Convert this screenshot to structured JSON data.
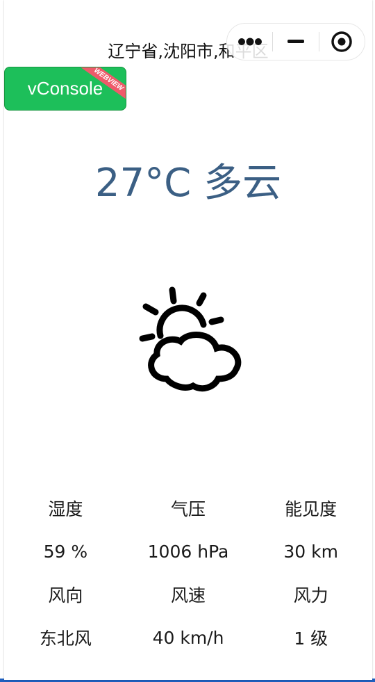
{
  "location": "辽宁省,沈阳市,和平区",
  "headline": {
    "temperature": "27°C",
    "condition": "多云",
    "text": "27°C 多云"
  },
  "capsule": {
    "more_icon": "more-dots-icon",
    "minimize_icon": "minimize-icon",
    "close_icon": "target-close-icon"
  },
  "vconsole": {
    "label": "vConsole",
    "ribbon": "WEBVIEW",
    "color": "#1dbf5a"
  },
  "weather_icon": "partly-cloudy-icon",
  "stats": {
    "row1_labels": [
      "湿度",
      "气压",
      "能见度"
    ],
    "row1_values": [
      "59 %",
      "1006 hPa",
      "30 km"
    ],
    "row2_labels": [
      "风向",
      "风速",
      "风力"
    ],
    "row2_values": [
      "东北风",
      "40 km/h",
      "1 级"
    ]
  },
  "colors": {
    "headline": "#3b5f84",
    "text": "#1a1a1a"
  }
}
